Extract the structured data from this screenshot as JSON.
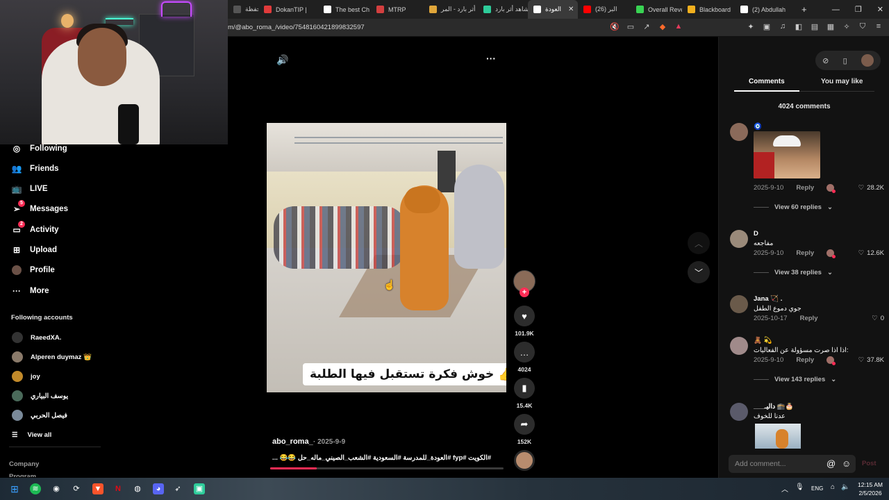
{
  "browser": {
    "tabs": [
      {
        "title": "المحفظة |",
        "color": "#555555",
        "icon": "wallet-icon",
        "w": 44
      },
      {
        "title": "DokanTIP |",
        "color": "#e03b3b",
        "icon": "store-icon",
        "w": 86
      },
      {
        "title": "The best Ch",
        "color": "#ffffff",
        "icon": "diamond-icon",
        "w": 76
      },
      {
        "title": "MTRP",
        "color": "#d33f3f",
        "icon": "mtrp-icon",
        "w": 76
      },
      {
        "title": "أثر بارد - المر",
        "color": "#e0a63a",
        "icon": "book-icon",
        "w": 78
      },
      {
        "title": "شاهد أثر بارد",
        "color": "#2ecc9a",
        "icon": "play-icon",
        "w": 72
      },
      {
        "title": "العودة",
        "color": "#ffffff",
        "icon": "tiktok-icon",
        "w": 72,
        "active": true
      },
      {
        "title": "(26) البر",
        "color": "#ff0000",
        "icon": "youtube-icon",
        "w": 76
      },
      {
        "title": "Overall Reve",
        "color": "#39d353",
        "icon": "chart-icon",
        "w": 74
      },
      {
        "title": "Blackboard",
        "color": "#f2b01e",
        "icon": "blackboard-icon",
        "w": 76
      },
      {
        "title": "(2) Abdullah",
        "color": "#ffffff",
        "icon": "x-icon",
        "w": 76
      }
    ],
    "url": "m/@abo_roma_/video/7548160421899832597"
  },
  "nav": {
    "following": "Following",
    "friends": "Friends",
    "live": "LIVE",
    "messages": "Messages",
    "messages_badge": "5",
    "activity": "Activity",
    "activity_badge": "2",
    "upload": "Upload",
    "profile": "Profile",
    "more": "More",
    "following_accounts_title": "Following accounts",
    "accounts": [
      {
        "name": "RaeedXA.",
        "color": "#333333"
      },
      {
        "name": "Alperen duymaz 👑",
        "color": "#8a7a6a"
      },
      {
        "name": "joy",
        "color": "#c28a2a"
      },
      {
        "name": "يوسف البياري",
        "color": "#4a6a5a"
      },
      {
        "name": "فيصل الحربي",
        "color": "#7a8a9a"
      }
    ],
    "view_all": "View all",
    "company": "Company",
    "program": "Program"
  },
  "video": {
    "caption": "خوش فكرة تستقبل فيها الطلبة",
    "author": "abo_roma_",
    "date": "· 2025-9-9",
    "description": "#الكويت #fyp #العودة_للمدرسة #السعودية #الشعب_الصيني_ماله_حل 😂😂 ...",
    "progress": 0.2
  },
  "actions": {
    "likes": "101.9K",
    "comments": "4024",
    "saves": "15.4K",
    "shares": "152K"
  },
  "panel": {
    "tab_comments": "Comments",
    "tab_you_may_like": "You may like",
    "comment_count": "4024 comments",
    "comments": [
      {
        "name": "🧿",
        "text": "",
        "date": "2025-9-10",
        "likes": "28.2K",
        "replies": "View 60 replies",
        "av": "#8b6a5a",
        "meme": true
      },
      {
        "name": "D",
        "text": "مفاجعه",
        "date": "2025-9-10",
        "likes": "12.6K",
        "replies": "View 38 replies",
        "av": "#9a8a7a"
      },
      {
        "name": "Jana 🏹 .",
        "text": "جوي دموع الطفل",
        "date": "2025-10-17",
        "likes": "0",
        "replies": "",
        "av": "#6a5a4a"
      },
      {
        "name": "🧸 💫",
        "text": "اذا اذا صرت مسؤولة عن الفعاليات:",
        "date": "2025-9-10",
        "likes": "37.8K",
        "replies": "View 143 replies",
        "av": "#a08a8a"
      },
      {
        "name": "___داليـ 🕋🎂",
        "text": "عدنا للخوف",
        "date": "",
        "likes": "",
        "replies": "",
        "av": "#5a5a6a",
        "meme2": true
      }
    ],
    "reply_label": "Reply",
    "add_comment_placeholder": "Add comment...",
    "post_label": "Post"
  },
  "taskbar": {
    "lang": "ENG",
    "time": "12:15 AM",
    "date": "2/5/2026"
  }
}
